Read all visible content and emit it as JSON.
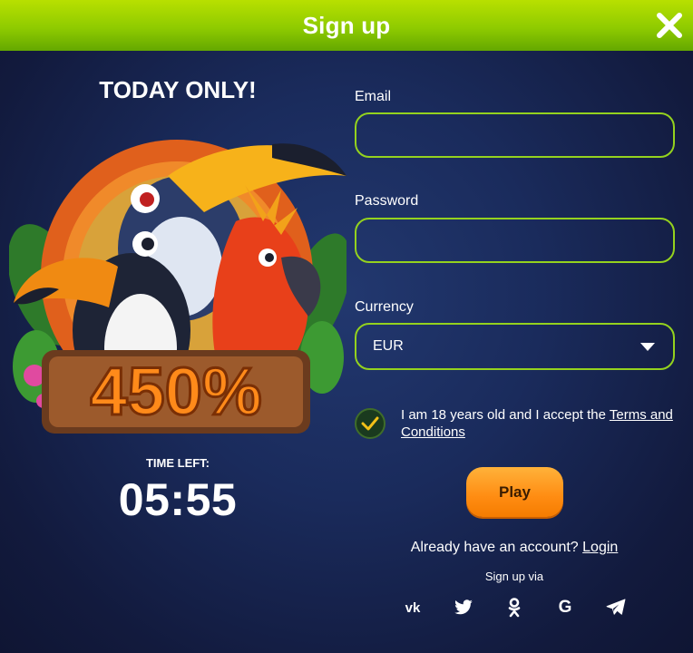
{
  "header": {
    "title": "Sign up"
  },
  "promo": {
    "headline": "TODAY ONLY!",
    "bonus": "450%",
    "timer_label": "TIME LEFT:",
    "timer_value": "05:55"
  },
  "form": {
    "email_label": "Email",
    "email_value": "",
    "password_label": "Password",
    "password_value": "",
    "currency_label": "Currency",
    "currency_value": "EUR",
    "terms_text": "I am 18 years old and I accept the ",
    "terms_link": "Terms and Conditions",
    "terms_checked": true,
    "play_label": "Play"
  },
  "footer": {
    "have_account_text": "Already have an account? ",
    "login_link": "Login",
    "signup_via": "Sign up via",
    "socials": [
      {
        "name": "vk-icon",
        "glyph": "vk"
      },
      {
        "name": "twitter-icon",
        "glyph": ""
      },
      {
        "name": "odnoklassniki-icon",
        "glyph": ""
      },
      {
        "name": "google-icon",
        "glyph": "G"
      },
      {
        "name": "telegram-icon",
        "glyph": ""
      }
    ]
  },
  "colors": {
    "accent_green": "#94d21e",
    "header_green": "#8fcb00",
    "play_orange": "#ff8c12",
    "background": "#1a2b5c"
  }
}
